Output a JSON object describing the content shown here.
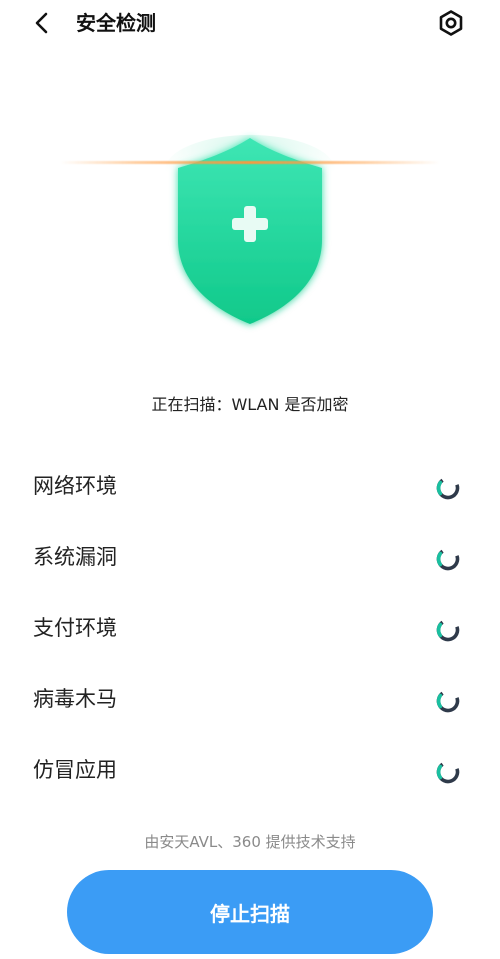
{
  "header": {
    "title": "安全检测"
  },
  "scan": {
    "status_text": "正在扫描：WLAN 是否加密"
  },
  "checks": [
    {
      "label": "网络环境"
    },
    {
      "label": "系统漏洞"
    },
    {
      "label": "支付环境"
    },
    {
      "label": "病毒木马"
    },
    {
      "label": "仿冒应用"
    }
  ],
  "footer": {
    "support_text": "由安天AVL、360 提供技术支持",
    "stop_label": "停止扫描"
  },
  "icons": {
    "back": "chevron-left-icon",
    "settings": "hexagon-gear-icon",
    "shield": "shield-plus-icon",
    "spinner": "loading-spinner-icon"
  },
  "colors": {
    "shield_green": "#1fd69a",
    "spinner_teal": "#19c0a0",
    "spinner_dark": "#2f3a4a",
    "button_blue": "#3b9cf5",
    "scan_line": "#ffa040"
  }
}
